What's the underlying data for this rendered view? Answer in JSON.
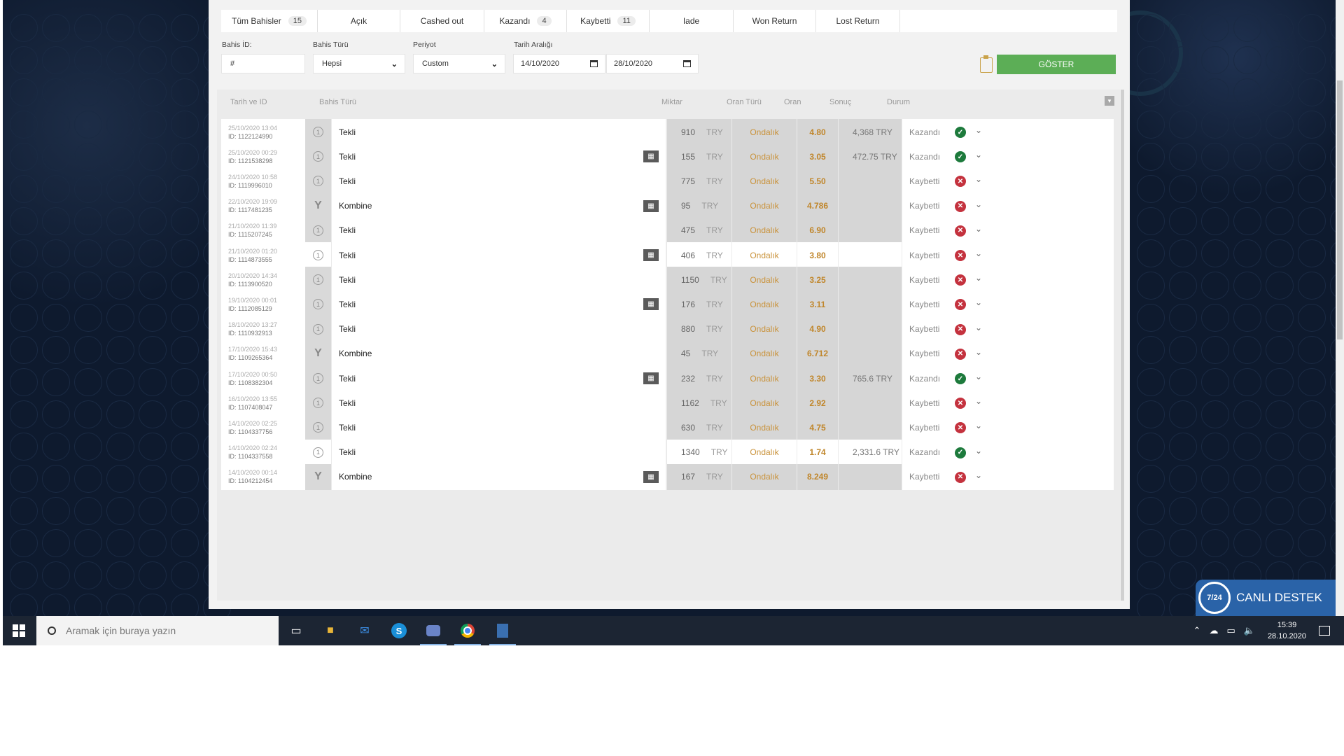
{
  "tabs": [
    {
      "label": "Tüm Bahisler",
      "count": "15",
      "width": 138,
      "active": false
    },
    {
      "label": "Açık",
      "count": "",
      "width": 118,
      "active": false
    },
    {
      "label": "Cashed out",
      "count": "",
      "width": 120,
      "active": false
    },
    {
      "label": "Kazandı",
      "count": "4",
      "width": 118,
      "active": false
    },
    {
      "label": "Kaybetti",
      "count": "11",
      "width": 118,
      "active": false
    },
    {
      "label": "Iade",
      "count": "",
      "width": 120,
      "active": false
    },
    {
      "label": "Won Return",
      "count": "",
      "width": 118,
      "active": false
    },
    {
      "label": "Lost Return",
      "count": "",
      "width": 120,
      "active": false
    }
  ],
  "filters": {
    "bet_id": {
      "label": "Bahis İD:",
      "value": "#"
    },
    "bet_type": {
      "label": "Bahis Türü",
      "value": "Hepsi"
    },
    "period": {
      "label": "Periyot",
      "value": "Custom"
    },
    "date_range": {
      "label": "Tarih Aralığı",
      "from": "14/10/2020",
      "to": "28/10/2020"
    },
    "show_button": "GÖSTER"
  },
  "table": {
    "headers": {
      "date_id": "Tarih ve ID",
      "bet_type": "Bahis Türü",
      "amount": "Miktar",
      "odds_type": "Oran Türü",
      "odds": "Oran",
      "result": "Sonuç",
      "status": "Durum"
    },
    "rows": [
      {
        "date": "25/10/2020 13:04",
        "id": "ID: 1122124990",
        "kind": "single",
        "type": "Tekli",
        "gift": false,
        "amount": "910",
        "currency": "TRY",
        "odds_type": "Ondalık",
        "odds": "4.80",
        "result": "4,368 TRY",
        "status": "Kazandı",
        "win": true,
        "white": false
      },
      {
        "date": "25/10/2020 00:29",
        "id": "ID: 1121538298",
        "kind": "single",
        "type": "Tekli",
        "gift": true,
        "amount": "155",
        "currency": "TRY",
        "odds_type": "Ondalık",
        "odds": "3.05",
        "result": "472.75 TRY",
        "status": "Kazandı",
        "win": true,
        "white": false
      },
      {
        "date": "24/10/2020 10:58",
        "id": "ID: 1119996010",
        "kind": "single",
        "type": "Tekli",
        "gift": false,
        "amount": "775",
        "currency": "TRY",
        "odds_type": "Ondalık",
        "odds": "5.50",
        "result": "",
        "status": "Kaybetti",
        "win": false,
        "white": false
      },
      {
        "date": "22/10/2020 19:09",
        "id": "ID: 1117481235",
        "kind": "combo",
        "type": "Kombine",
        "gift": true,
        "amount": "95",
        "currency": "TRY",
        "odds_type": "Ondalık",
        "odds": "4.786",
        "result": "",
        "status": "Kaybetti",
        "win": false,
        "white": false
      },
      {
        "date": "21/10/2020 11:39",
        "id": "ID: 1115207245",
        "kind": "single",
        "type": "Tekli",
        "gift": false,
        "amount": "475",
        "currency": "TRY",
        "odds_type": "Ondalık",
        "odds": "6.90",
        "result": "",
        "status": "Kaybetti",
        "win": false,
        "white": false
      },
      {
        "date": "21/10/2020 01:20",
        "id": "ID: 1114873555",
        "kind": "single",
        "type": "Tekli",
        "gift": true,
        "amount": "406",
        "currency": "TRY",
        "odds_type": "Ondalık",
        "odds": "3.80",
        "result": "",
        "status": "Kaybetti",
        "win": false,
        "white": true
      },
      {
        "date": "20/10/2020 14:34",
        "id": "ID: 1113900520",
        "kind": "single",
        "type": "Tekli",
        "gift": false,
        "amount": "1150",
        "currency": "TRY",
        "odds_type": "Ondalık",
        "odds": "3.25",
        "result": "",
        "status": "Kaybetti",
        "win": false,
        "white": false
      },
      {
        "date": "19/10/2020 00:01",
        "id": "ID: 1112085129",
        "kind": "single",
        "type": "Tekli",
        "gift": true,
        "amount": "176",
        "currency": "TRY",
        "odds_type": "Ondalık",
        "odds": "3.11",
        "result": "",
        "status": "Kaybetti",
        "win": false,
        "white": false
      },
      {
        "date": "18/10/2020 13:27",
        "id": "ID: 1110932913",
        "kind": "single",
        "type": "Tekli",
        "gift": false,
        "amount": "880",
        "currency": "TRY",
        "odds_type": "Ondalık",
        "odds": "4.90",
        "result": "",
        "status": "Kaybetti",
        "win": false,
        "white": false
      },
      {
        "date": "17/10/2020 15:43",
        "id": "ID: 1109265364",
        "kind": "combo",
        "type": "Kombine",
        "gift": false,
        "amount": "45",
        "currency": "TRY",
        "odds_type": "Ondalık",
        "odds": "6.712",
        "result": "",
        "status": "Kaybetti",
        "win": false,
        "white": false
      },
      {
        "date": "17/10/2020 00:50",
        "id": "ID: 1108382304",
        "kind": "single",
        "type": "Tekli",
        "gift": true,
        "amount": "232",
        "currency": "TRY",
        "odds_type": "Ondalık",
        "odds": "3.30",
        "result": "765.6 TRY",
        "status": "Kazandı",
        "win": true,
        "white": false
      },
      {
        "date": "16/10/2020 13:55",
        "id": "ID: 1107408047",
        "kind": "single",
        "type": "Tekli",
        "gift": false,
        "amount": "1162",
        "currency": "TRY",
        "odds_type": "Ondalık",
        "odds": "2.92",
        "result": "",
        "status": "Kaybetti",
        "win": false,
        "white": false
      },
      {
        "date": "14/10/2020 02:25",
        "id": "ID: 1104337756",
        "kind": "single",
        "type": "Tekli",
        "gift": false,
        "amount": "630",
        "currency": "TRY",
        "odds_type": "Ondalık",
        "odds": "4.75",
        "result": "",
        "status": "Kaybetti",
        "win": false,
        "white": false
      },
      {
        "date": "14/10/2020 02:24",
        "id": "ID: 1104337558",
        "kind": "single",
        "type": "Tekli",
        "gift": false,
        "amount": "1340",
        "currency": "TRY",
        "odds_type": "Ondalık",
        "odds": "1.74",
        "result": "2,331.6 TRY",
        "status": "Kazandı",
        "win": true,
        "white": true
      },
      {
        "date": "14/10/2020 00:14",
        "id": "ID: 1104212454",
        "kind": "combo",
        "type": "Kombine",
        "gift": true,
        "amount": "167",
        "currency": "TRY",
        "odds_type": "Ondalık",
        "odds": "8.249",
        "result": "",
        "status": "Kaybetti",
        "win": false,
        "white": false
      }
    ]
  },
  "support": {
    "badge": "7/24",
    "label": "CANLI DESTEK"
  },
  "taskbar": {
    "search_placeholder": "Aramak için buraya yazın",
    "time": "15:39",
    "date": "28.10.2020"
  },
  "colors": {
    "show_button": "#5cae56",
    "win": "#1d7a3c",
    "lose": "#c4323e",
    "odds": "#c0862b",
    "taskbar": "#1c2533"
  }
}
